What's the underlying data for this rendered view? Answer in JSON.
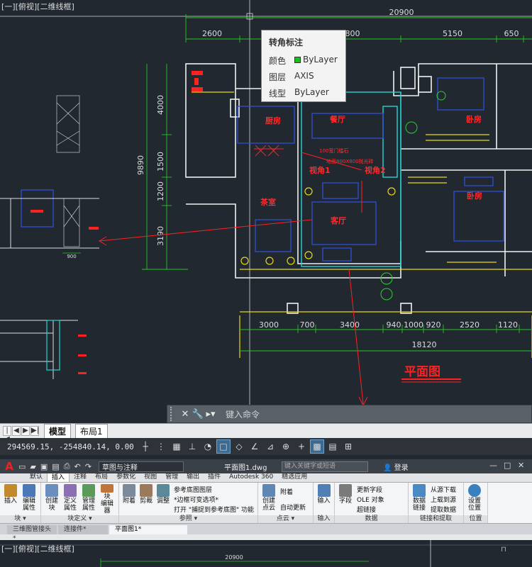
{
  "viewport": {
    "label": "[一][俯视][二维线框]",
    "dims_top": [
      "20900",
      "2600",
      "800",
      "5150",
      "650"
    ],
    "dims_left": [
      "4000",
      "9890",
      "1500",
      "1200",
      "3190"
    ],
    "dims_bottom": [
      "3000",
      "700",
      "3400",
      "940",
      "1000",
      "920",
      "2520",
      "1120"
    ],
    "dim_total_bottom": "18120",
    "dim_detail": "900",
    "rooms": [
      "厨房",
      "餐厅",
      "卧房",
      "卧房",
      "茶室",
      "客厅",
      "视角1",
      "视角2"
    ],
    "notes": [
      "100宽门槛石",
      "地面800X800抛光砖"
    ],
    "plan_title": "平面图"
  },
  "tooltip": {
    "title": "转角标注",
    "rows": [
      {
        "key": "颜色",
        "value": "ByLayer"
      },
      {
        "key": "图层",
        "value": "AXIS"
      },
      {
        "key": "线型",
        "value": "ByLayer"
      }
    ]
  },
  "command": {
    "close": "✕",
    "settings": "🔧",
    "prompt": "键入命令"
  },
  "layout_tabs": {
    "model": "模型",
    "layout1": "布局1"
  },
  "status": {
    "coords": "294569.15, -254840.14, 0.00"
  },
  "window2": {
    "workspace": "草图与注释",
    "doc_title": "平面图1.dwg",
    "search_placeholder": "键入关键字或短语",
    "login": "登录",
    "ribbon_tabs": [
      "默认",
      "插入",
      "注释",
      "布局",
      "参数化",
      "视图",
      "管理",
      "输出",
      "插件",
      "Autodesk 360",
      "精选应用"
    ],
    "active_tab": "插入",
    "panels": {
      "block": {
        "title": "块 ▾",
        "tools": [
          "插入",
          "编辑\n属性"
        ]
      },
      "block_def": {
        "title": "块定义 ▾",
        "tools": [
          "创建\n块",
          "定义\n属性",
          "管理\n属性",
          "块\n编辑器"
        ]
      },
      "reference": {
        "title": "参照 ▾",
        "tools": [
          "附着",
          "剪裁",
          "调整"
        ],
        "stack": [
          "参考底图图层",
          "*边框可变选项*",
          "打开 \"捕捉到参考底图\" 功能"
        ]
      },
      "pointcloud": {
        "title": "点云 ▾",
        "tools": [
          "创建\n点云"
        ],
        "stack": [
          "附着",
          "自动更新"
        ]
      },
      "import": {
        "title": "输入",
        "tools": [
          "输入"
        ]
      },
      "data": {
        "title": "数据",
        "tools": [
          "字段"
        ],
        "stack": [
          "更新字段",
          "OLE 对象",
          "超链接"
        ]
      },
      "link": {
        "title": "链接和提取",
        "tools": [
          "数据\n链接"
        ],
        "stack": [
          "从源下载",
          "上载到源",
          "提取数据"
        ]
      },
      "location": {
        "title": "位置",
        "tools": [
          "设置\n位置"
        ]
      }
    },
    "doc_tabs": [
      "三维图管接头*",
      "连接件*",
      "平面图1*"
    ],
    "viewport_label": "[一][俯视][二维线框]",
    "dim_top": "20900"
  }
}
